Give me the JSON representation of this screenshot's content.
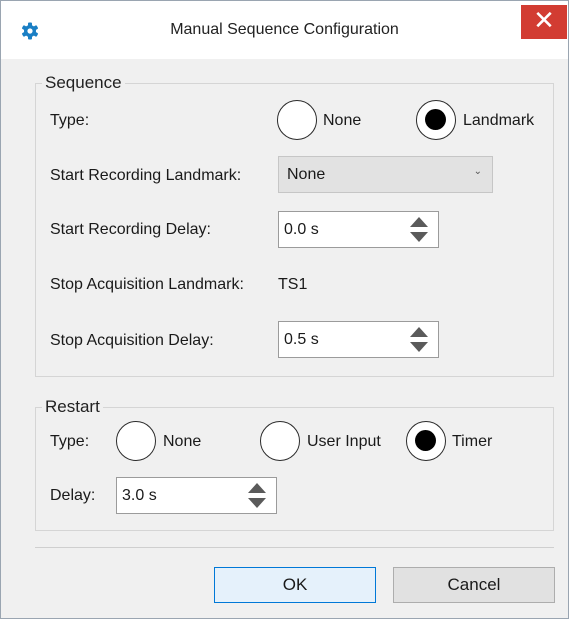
{
  "window": {
    "title": "Manual Sequence Configuration",
    "close_glyph": "✕",
    "icon": "gear-icon"
  },
  "sequence": {
    "legend": "Sequence",
    "type_label": "Type:",
    "type_options": [
      {
        "label": "None",
        "selected": false
      },
      {
        "label": "Landmark",
        "selected": true
      }
    ],
    "start_recording_landmark_label": "Start Recording Landmark:",
    "start_recording_landmark_value": "None",
    "start_recording_delay_label": "Start Recording Delay:",
    "start_recording_delay_value": "0.0 s",
    "stop_acquisition_landmark_label": "Stop Acquisition Landmark:",
    "stop_acquisition_landmark_value": "TS1",
    "stop_acquisition_delay_label": "Stop Acquisition Delay:",
    "stop_acquisition_delay_value": "0.5 s"
  },
  "restart": {
    "legend": "Restart",
    "type_label": "Type:",
    "type_options": [
      {
        "label": "None",
        "selected": false
      },
      {
        "label": "User Input",
        "selected": false
      },
      {
        "label": "Timer",
        "selected": true
      }
    ],
    "delay_label": "Delay:",
    "delay_value": "3.0 s"
  },
  "buttons": {
    "ok": "OK",
    "cancel": "Cancel"
  },
  "colors": {
    "close_button": "#d23c32",
    "app_icon": "#1a7fc4",
    "ok_focus_border": "#0078d7"
  }
}
